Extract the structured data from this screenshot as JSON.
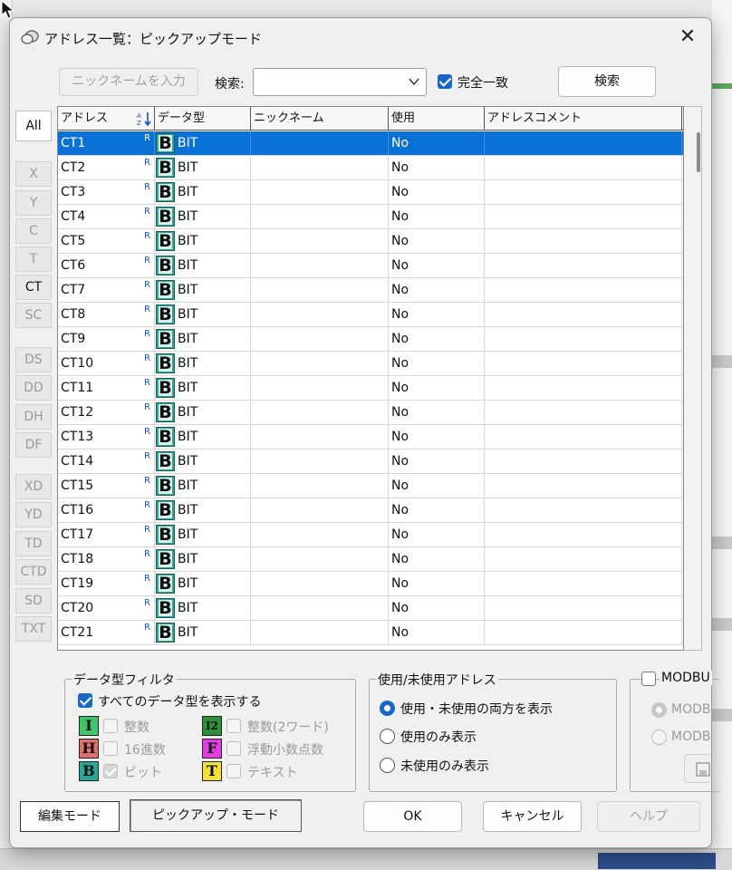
{
  "dialog": {
    "title": "アドレス一覧：ピックアップモード",
    "close": "✕"
  },
  "toolbar": {
    "nickname_button": "ニックネームを入力",
    "search_label": "検索:",
    "search_value": "",
    "exact_match_label": "完全一致",
    "exact_match_checked": true,
    "search_button": "検索"
  },
  "left_tabs": [
    {
      "label": "All",
      "active": true,
      "enabled": true
    },
    {
      "label": "X",
      "active": false,
      "enabled": false
    },
    {
      "label": "Y",
      "active": false,
      "enabled": false
    },
    {
      "label": "C",
      "active": false,
      "enabled": false
    },
    {
      "label": "T",
      "active": false,
      "enabled": false
    },
    {
      "label": "CT",
      "active": false,
      "enabled": true
    },
    {
      "label": "SC",
      "active": false,
      "enabled": false
    },
    {
      "label": "DS",
      "active": false,
      "enabled": false
    },
    {
      "label": "DD",
      "active": false,
      "enabled": false
    },
    {
      "label": "DH",
      "active": false,
      "enabled": false
    },
    {
      "label": "DF",
      "active": false,
      "enabled": false
    },
    {
      "label": "XD",
      "active": false,
      "enabled": false
    },
    {
      "label": "YD",
      "active": false,
      "enabled": false
    },
    {
      "label": "TD",
      "active": false,
      "enabled": false
    },
    {
      "label": "CTD",
      "active": false,
      "enabled": false
    },
    {
      "label": "SD",
      "active": false,
      "enabled": false
    },
    {
      "label": "TXT",
      "active": false,
      "enabled": false
    }
  ],
  "table": {
    "columns": [
      "アドレス",
      "データ型",
      "ニックネーム",
      "使用",
      "アドレスコメント"
    ],
    "sort_icon": "AZ-sort-icon",
    "row_marker": "R",
    "type_icon_letter": "B",
    "rows": [
      {
        "address": "CT1",
        "type": "BIT",
        "nickname": "",
        "used": "No",
        "comment": "",
        "selected": true
      },
      {
        "address": "CT2",
        "type": "BIT",
        "nickname": "",
        "used": "No",
        "comment": ""
      },
      {
        "address": "CT3",
        "type": "BIT",
        "nickname": "",
        "used": "No",
        "comment": ""
      },
      {
        "address": "CT4",
        "type": "BIT",
        "nickname": "",
        "used": "No",
        "comment": ""
      },
      {
        "address": "CT5",
        "type": "BIT",
        "nickname": "",
        "used": "No",
        "comment": ""
      },
      {
        "address": "CT6",
        "type": "BIT",
        "nickname": "",
        "used": "No",
        "comment": ""
      },
      {
        "address": "CT7",
        "type": "BIT",
        "nickname": "",
        "used": "No",
        "comment": ""
      },
      {
        "address": "CT8",
        "type": "BIT",
        "nickname": "",
        "used": "No",
        "comment": ""
      },
      {
        "address": "CT9",
        "type": "BIT",
        "nickname": "",
        "used": "No",
        "comment": ""
      },
      {
        "address": "CT10",
        "type": "BIT",
        "nickname": "",
        "used": "No",
        "comment": ""
      },
      {
        "address": "CT11",
        "type": "BIT",
        "nickname": "",
        "used": "No",
        "comment": ""
      },
      {
        "address": "CT12",
        "type": "BIT",
        "nickname": "",
        "used": "No",
        "comment": ""
      },
      {
        "address": "CT13",
        "type": "BIT",
        "nickname": "",
        "used": "No",
        "comment": ""
      },
      {
        "address": "CT14",
        "type": "BIT",
        "nickname": "",
        "used": "No",
        "comment": ""
      },
      {
        "address": "CT15",
        "type": "BIT",
        "nickname": "",
        "used": "No",
        "comment": ""
      },
      {
        "address": "CT16",
        "type": "BIT",
        "nickname": "",
        "used": "No",
        "comment": ""
      },
      {
        "address": "CT17",
        "type": "BIT",
        "nickname": "",
        "used": "No",
        "comment": ""
      },
      {
        "address": "CT18",
        "type": "BIT",
        "nickname": "",
        "used": "No",
        "comment": ""
      },
      {
        "address": "CT19",
        "type": "BIT",
        "nickname": "",
        "used": "No",
        "comment": ""
      },
      {
        "address": "CT20",
        "type": "BIT",
        "nickname": "",
        "used": "No",
        "comment": ""
      },
      {
        "address": "CT21",
        "type": "BIT",
        "nickname": "",
        "used": "No",
        "comment": ""
      }
    ]
  },
  "datatype_filter": {
    "title": "データ型フィルタ",
    "show_all_label": "すべてのデータ型を表示する",
    "show_all_checked": true,
    "items": [
      {
        "icon": "I",
        "label": "整数",
        "color": "#3fc46a"
      },
      {
        "icon": "I2",
        "label": "整数(2ワード)",
        "color": "#2f8f3a"
      },
      {
        "icon": "H",
        "label": "16進数",
        "color": "#e07070"
      },
      {
        "icon": "F",
        "label": "浮動小数点数",
        "color": "#e040e0"
      },
      {
        "icon": "B",
        "label": "ビット",
        "color": "#2ba796"
      },
      {
        "icon": "T",
        "label": "テキスト",
        "color": "#f0e040"
      }
    ]
  },
  "usage_filter": {
    "title": "使用/未使用アドレス",
    "options": [
      {
        "label": "使用・未使用の両方を表示",
        "selected": true
      },
      {
        "label": "使用のみ表示",
        "selected": false
      },
      {
        "label": "未使用のみ表示",
        "selected": false
      }
    ]
  },
  "modbus": {
    "title": "MODBU",
    "opt1": "MODB",
    "opt2": "MODB"
  },
  "footer": {
    "edit_mode": "編集モード",
    "pickup_mode": "ピックアップ・モード",
    "ok": "OK",
    "cancel": "キャンセル",
    "help": "ヘルプ"
  },
  "colors": {
    "selection": "#0a72d6",
    "accent": "#1a66c9",
    "bit_icon": "#2ba796"
  }
}
